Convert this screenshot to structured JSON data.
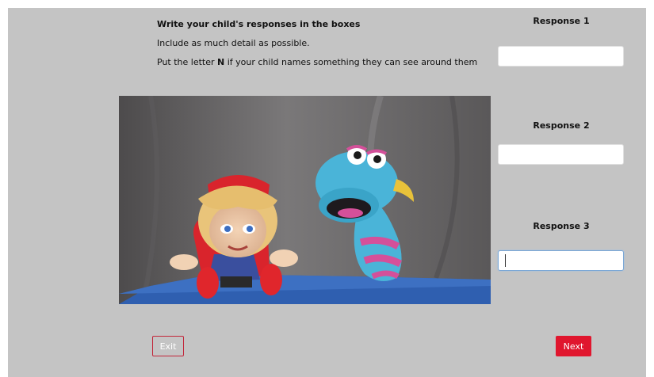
{
  "instructions": {
    "title": "Write your child's responses in the boxes",
    "line1": "Include as much detail as possible.",
    "line2_prefix": "Put the letter ",
    "line2_letter": "N",
    "line2_suffix": " if your child names something they can see around them"
  },
  "responses": [
    {
      "label": "Response 1",
      "value": ""
    },
    {
      "label": "Response 2",
      "value": ""
    },
    {
      "label": "Response 3",
      "value": ""
    }
  ],
  "buttons": {
    "exit_label": "Exit",
    "next_label": "Next"
  },
  "colors": {
    "panel_bg": "#c4c4c4",
    "next_bg": "#e0162e",
    "exit_border": "#c2263a",
    "focus_border": "#7aa7d6"
  }
}
